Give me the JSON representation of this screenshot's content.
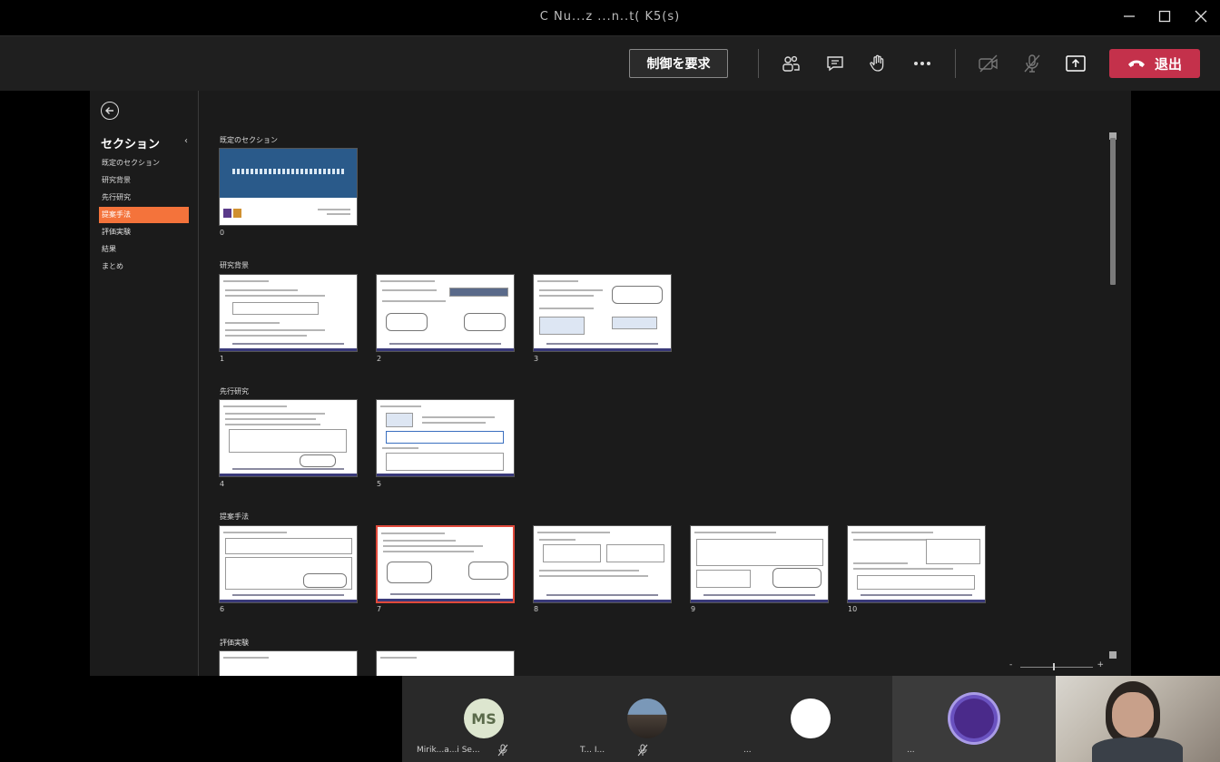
{
  "window": {
    "title": "C Nu...z ...n..t( K5(s)"
  },
  "toolbar": {
    "request_control_label": "制御を要求",
    "leave_label": "退出",
    "leave_color": "#c4314b",
    "icons": [
      "participants-icon",
      "chat-icon",
      "raise-hand-icon",
      "more-icon",
      "camera-off-icon",
      "mic-off-icon",
      "share-icon",
      "phone-icon"
    ]
  },
  "sidebar": {
    "heading": "セクション",
    "items": [
      {
        "label": "既定のセクション",
        "active": false
      },
      {
        "label": "研究背景",
        "active": false
      },
      {
        "label": "先行研究",
        "active": false
      },
      {
        "label": "提案手法",
        "active": true
      },
      {
        "label": "評価実験",
        "active": false
      },
      {
        "label": "結果",
        "active": false
      },
      {
        "label": "まとめ",
        "active": false
      }
    ],
    "active_color": "#f4733b"
  },
  "sections": [
    {
      "label": "既定のセクション",
      "slides": [
        {
          "num": "0"
        }
      ]
    },
    {
      "label": "研究背景",
      "slides": [
        {
          "num": "1"
        },
        {
          "num": "2"
        },
        {
          "num": "3"
        }
      ]
    },
    {
      "label": "先行研究",
      "slides": [
        {
          "num": "4"
        },
        {
          "num": "5"
        }
      ]
    },
    {
      "label": "提案手法",
      "slides": [
        {
          "num": "6"
        },
        {
          "num": "7",
          "selected": true
        },
        {
          "num": "8"
        },
        {
          "num": "9"
        },
        {
          "num": "10"
        }
      ]
    },
    {
      "label": "評価実験",
      "slides": []
    }
  ],
  "zoom": {
    "minus": "-",
    "plus": "+"
  },
  "participants": [
    {
      "initials": "MS",
      "name": "Mirik...a...i Se...",
      "muted": true,
      "avatar_color": "#dde6cf"
    },
    {
      "initials": "",
      "name": "T... I...",
      "muted": true,
      "avatar_color": "#5a6a7a"
    },
    {
      "initials": "",
      "name": "...",
      "muted": false,
      "avatar_color": "#ffffff"
    },
    {
      "initials": "",
      "name": "...",
      "muted": false,
      "avatar_color": "#4a2a8a"
    }
  ]
}
